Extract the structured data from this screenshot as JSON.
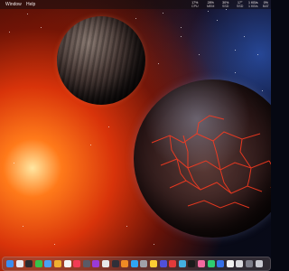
{
  "menubar": {
    "items": [
      "Window",
      "Help"
    ],
    "status": [
      {
        "value": "17%",
        "label": "CPU"
      },
      {
        "value": "28%",
        "label": "MEM"
      },
      {
        "value": "30%",
        "label": "SSD"
      },
      {
        "value": "17°",
        "label": "SSD"
      },
      {
        "value": "1 KB/s",
        "label": "1 KB/s"
      },
      {
        "value": "0%",
        "label": "BAT"
      }
    ]
  },
  "dock": {
    "apps": [
      {
        "name": "finder-icon",
        "color": "#3a8ef0"
      },
      {
        "name": "launchpad-icon",
        "color": "#e8e8ee"
      },
      {
        "name": "terminal-icon",
        "color": "#2a2a2e"
      },
      {
        "name": "messages-icon",
        "color": "#36c24a"
      },
      {
        "name": "mail-icon",
        "color": "#4aa0f5"
      },
      {
        "name": "photos-icon",
        "color": "#f0b030"
      },
      {
        "name": "calendar-icon",
        "color": "#f4f4f4"
      },
      {
        "name": "music-icon",
        "color": "#f23b55"
      },
      {
        "name": "app-icon-9",
        "color": "#5a5a66"
      },
      {
        "name": "app-icon-10",
        "color": "#9a3ad6"
      },
      {
        "name": "app-icon-11",
        "color": "#e8e8e8"
      },
      {
        "name": "app-icon-12",
        "color": "#2f2f38"
      },
      {
        "name": "app-icon-13",
        "color": "#f08a24"
      },
      {
        "name": "app-icon-14",
        "color": "#2fa4f2"
      },
      {
        "name": "app-icon-15",
        "color": "#a0a0a8"
      },
      {
        "name": "app-icon-16",
        "color": "#ffcc33"
      },
      {
        "name": "app-icon-17",
        "color": "#5050d8"
      },
      {
        "name": "app-icon-18",
        "color": "#e23a3a"
      },
      {
        "name": "app-icon-19",
        "color": "#44b0e0"
      },
      {
        "name": "app-icon-20",
        "color": "#1a1a1a"
      },
      {
        "name": "app-icon-21",
        "color": "#f26aa0"
      },
      {
        "name": "app-icon-22",
        "color": "#2ecc71"
      },
      {
        "name": "app-icon-23",
        "color": "#3570e8"
      },
      {
        "name": "app-icon-24",
        "color": "#f0f0f0"
      },
      {
        "name": "app-icon-25",
        "color": "#d9d9de"
      },
      {
        "name": "app-icon-26",
        "color": "#7a7a86"
      },
      {
        "name": "trash-icon",
        "color": "#c8c8d0"
      }
    ]
  }
}
